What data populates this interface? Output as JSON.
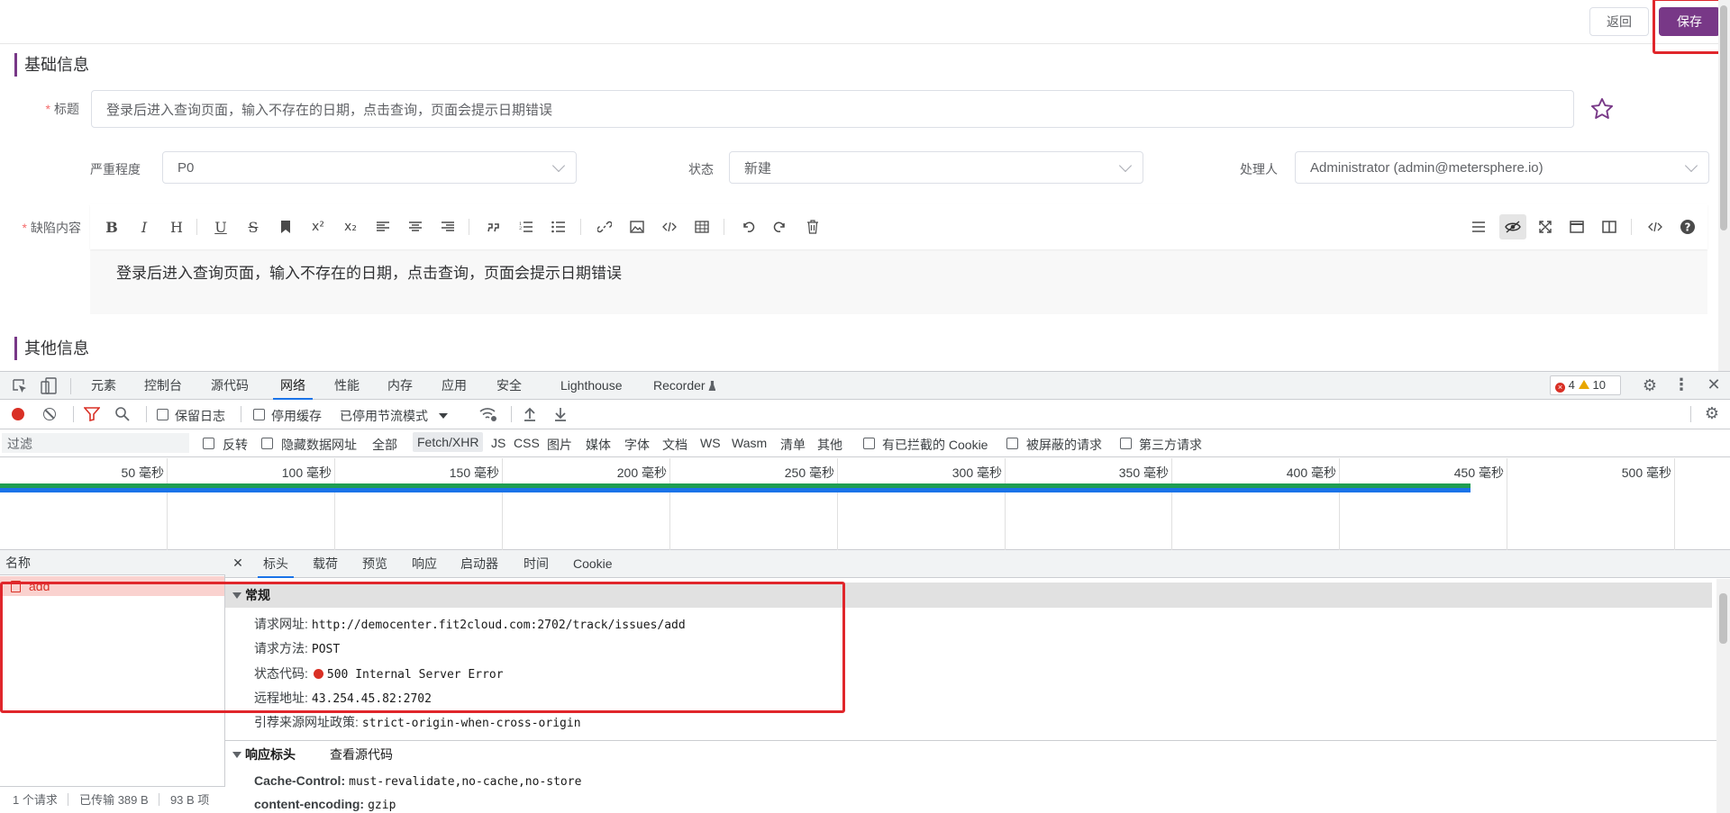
{
  "app": {
    "back_label": "返回",
    "save_label": "保存",
    "section_basic": "基础信息",
    "section_other": "其他信息",
    "title_label": "标题",
    "title_value": "登录后进入查询页面，输入不存在的日期，点击查询，页面会提示日期错误",
    "severity_label": "严重程度",
    "severity_value": "P0",
    "status_label": "状态",
    "status_value": "新建",
    "handler_label": "处理人",
    "handler_value": "Administrator (admin@metersphere.io)",
    "content_label": "缺陷内容",
    "content_value": "登录后进入查询页面，输入不存在的日期，点击查询，页面会提示日期错误",
    "accent_color": "#783887",
    "toolbar_glyphs": {
      "bold": "B",
      "italic": "I",
      "header": "H",
      "underline": "U",
      "strike": "S",
      "superscript": "x²",
      "subscript": "x₂"
    }
  },
  "devtools": {
    "tabs": [
      "元素",
      "控制台",
      "源代码",
      "网络",
      "性能",
      "内存",
      "应用",
      "安全",
      "Lighthouse",
      "Recorder"
    ],
    "active_tab": "网络",
    "error_count": "4",
    "warning_count": "10",
    "preserve_log": "保留日志",
    "disable_cache": "停用缓存",
    "throttle": "已停用节流模式",
    "filter_placeholder": "过滤",
    "invert": "反转",
    "hide_data_urls": "隐藏数据网址",
    "types": [
      "全部",
      "Fetch/XHR",
      "JS",
      "CSS",
      "图片",
      "媒体",
      "字体",
      "文档",
      "WS",
      "Wasm",
      "清单",
      "其他"
    ],
    "active_type": "Fetch/XHR",
    "blocked_cookies": "有已拦截的 Cookie",
    "blocked_requests": "被屏蔽的请求",
    "third_party": "第三方请求",
    "timeline_ticks": [
      "50 毫秒",
      "100 毫秒",
      "150 毫秒",
      "200 毫秒",
      "250 毫秒",
      "300 毫秒",
      "350 毫秒",
      "400 毫秒",
      "450 毫秒",
      "500 毫秒"
    ],
    "name_header": "名称",
    "request_name": "add",
    "footer_requests": "1 个请求",
    "footer_transferred": "已传输 389 B",
    "footer_resources": "93 B 项",
    "detail_tabs": [
      "标头",
      "载荷",
      "预览",
      "响应",
      "启动器",
      "时间",
      "Cookie"
    ],
    "active_detail_tab": "标头",
    "general_title": "常规",
    "general": {
      "url_key": "请求网址:",
      "url_val": "http://democenter.fit2cloud.com:2702/track/issues/add",
      "method_key": "请求方法:",
      "method_val": "POST",
      "status_key": "状态代码:",
      "status_val": "500 Internal Server Error",
      "remote_key": "远程地址:",
      "remote_val": "43.254.45.82:2702",
      "referrer_key": "引荐来源网址政策:",
      "referrer_val": "strict-origin-when-cross-origin"
    },
    "response_headers_title": "响应标头",
    "view_source": "查看源代码",
    "resp": {
      "cache_key": "Cache-Control:",
      "cache_val": "must-revalidate,no-cache,no-store",
      "enc_key": "content-encoding:",
      "enc_val": "gzip"
    }
  }
}
